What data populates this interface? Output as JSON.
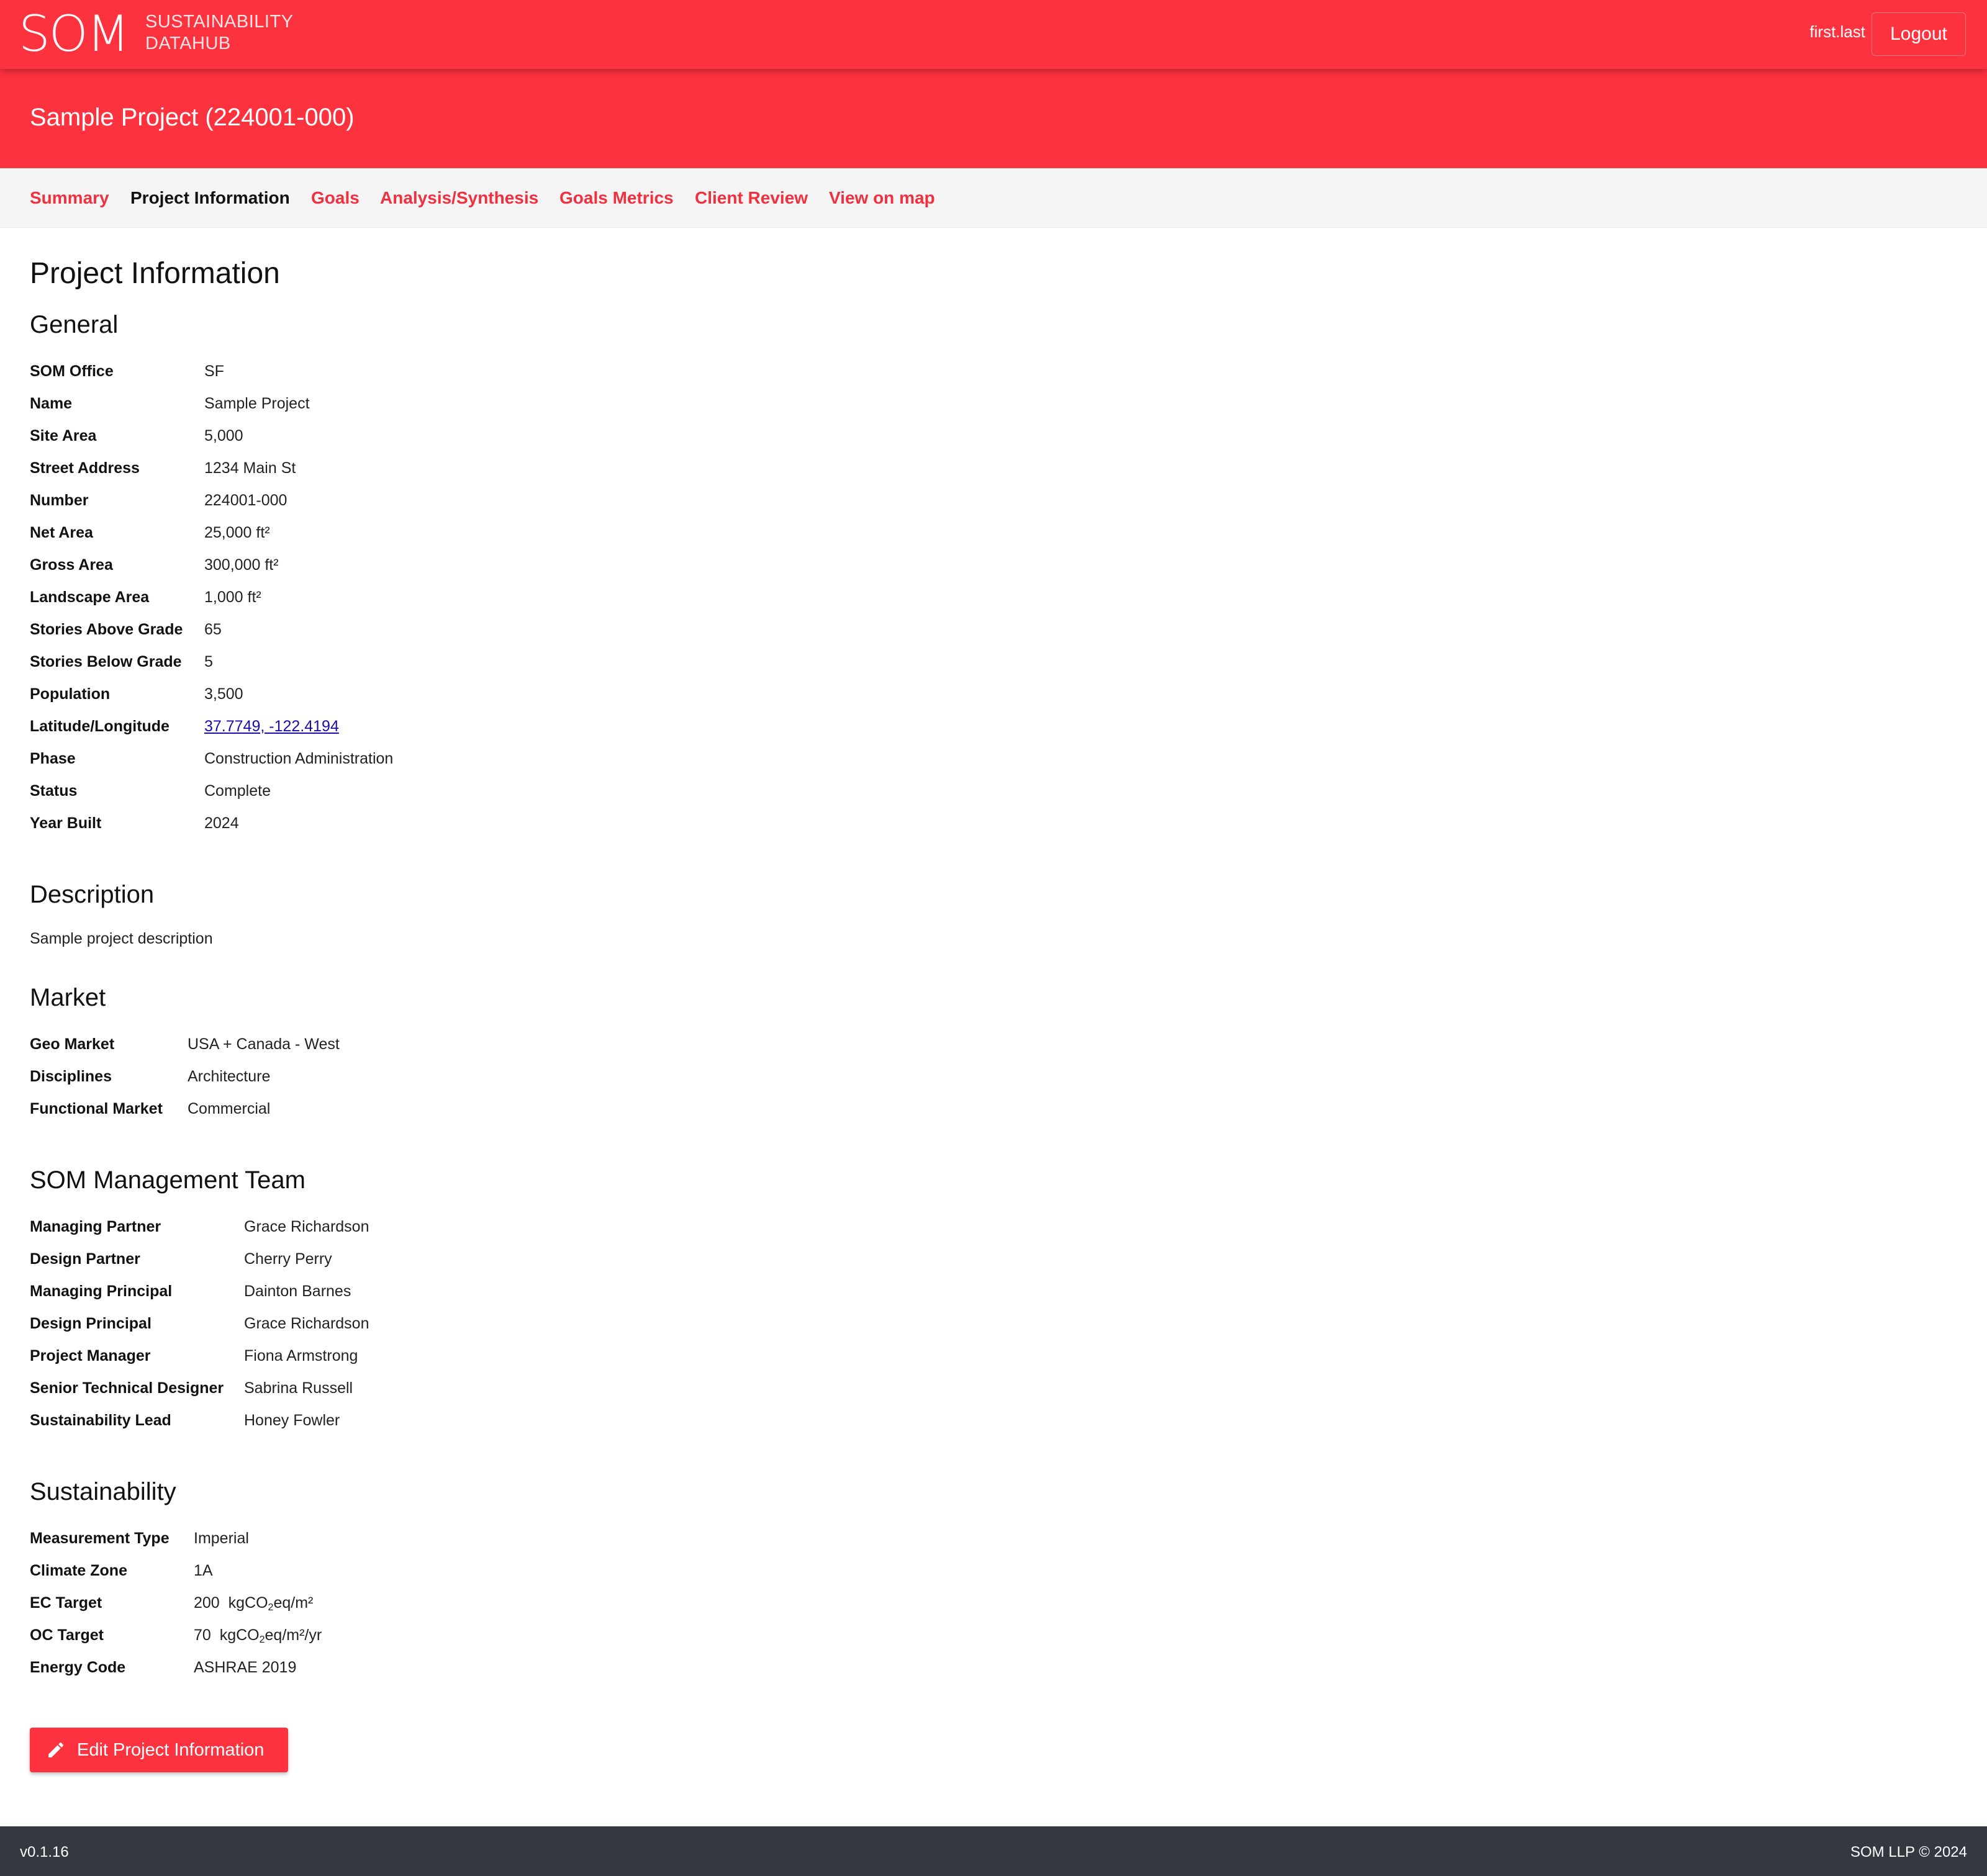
{
  "header": {
    "logo": "SOM",
    "app_name_line1": "SUSTAINABILITY",
    "app_name_line2": "DATAHUB",
    "username": "first.last",
    "logout_label": "Logout"
  },
  "project": {
    "title": "Sample Project (224001-000)"
  },
  "tabs": [
    {
      "label": "Summary",
      "active": false
    },
    {
      "label": "Project Information",
      "active": true
    },
    {
      "label": "Goals",
      "active": false
    },
    {
      "label": "Analysis/Synthesis",
      "active": false
    },
    {
      "label": "Goals Metrics",
      "active": false
    },
    {
      "label": "Client Review",
      "active": false
    },
    {
      "label": "View on map",
      "active": false
    }
  ],
  "page_title": "Project Information",
  "general": {
    "heading": "General",
    "rows": [
      {
        "label": "SOM Office",
        "value": "SF"
      },
      {
        "label": "Name",
        "value": "Sample Project"
      },
      {
        "label": "Site Area",
        "value": "5,000"
      },
      {
        "label": "Street Address",
        "value": "1234 Main St"
      },
      {
        "label": "Number",
        "value": "224001-000"
      },
      {
        "label": "Net Area",
        "value": "25,000 ft²"
      },
      {
        "label": "Gross Area",
        "value": "300,000 ft²"
      },
      {
        "label": "Landscape Area",
        "value": "1,000 ft²"
      },
      {
        "label": "Stories Above Grade",
        "value": "65"
      },
      {
        "label": "Stories Below Grade",
        "value": "5"
      },
      {
        "label": "Population",
        "value": "3,500"
      },
      {
        "label": "Latitude/Longitude",
        "value": "37.7749, -122.4194"
      },
      {
        "label": "Phase",
        "value": "Construction Administration"
      },
      {
        "label": "Status",
        "value": "Complete"
      },
      {
        "label": "Year Built",
        "value": "2024"
      }
    ]
  },
  "description": {
    "heading": "Description",
    "text": "Sample project description"
  },
  "market": {
    "heading": "Market",
    "rows": [
      {
        "label": "Geo Market",
        "value": "USA + Canada - West"
      },
      {
        "label": "Disciplines",
        "value": "Architecture"
      },
      {
        "label": "Functional Market",
        "value": "Commercial"
      }
    ]
  },
  "team": {
    "heading": "SOM Management Team",
    "rows": [
      {
        "label": "Managing Partner",
        "value": "Grace Richardson"
      },
      {
        "label": "Design Partner",
        "value": "Cherry Perry"
      },
      {
        "label": "Managing Principal",
        "value": "Dainton Barnes"
      },
      {
        "label": "Design Principal",
        "value": "Grace Richardson"
      },
      {
        "label": "Project Manager",
        "value": "Fiona Armstrong"
      },
      {
        "label": "Senior Technical Designer",
        "value": "Sabrina Russell"
      },
      {
        "label": "Sustainability Lead",
        "value": "Honey Fowler"
      }
    ]
  },
  "sustainability": {
    "heading": "Sustainability",
    "measurement_type_label": "Measurement Type",
    "measurement_type": "Imperial",
    "climate_zone_label": "Climate Zone",
    "climate_zone": "1A",
    "ec_target_label": "EC Target",
    "ec_target_value": "200",
    "ec_unit_pre": "kgCO",
    "ec_unit_sub": "2",
    "ec_unit_post": "eq/m²",
    "oc_target_label": "OC Target",
    "oc_target_value": "70",
    "oc_unit_pre": "kgCO",
    "oc_unit_sub": "2",
    "oc_unit_post": "eq/m²/yr",
    "energy_code_label": "Energy Code",
    "energy_code": "ASHRAE 2019"
  },
  "edit_button": {
    "label": "Edit Project Information",
    "icon": "pencil-icon"
  },
  "footer": {
    "version": "v0.1.16",
    "copyright": "SOM LLP © 2024"
  },
  "colors": {
    "brand_red": "#fc323f",
    "footer_dark": "#343840",
    "link_blue": "#1a0dab"
  }
}
